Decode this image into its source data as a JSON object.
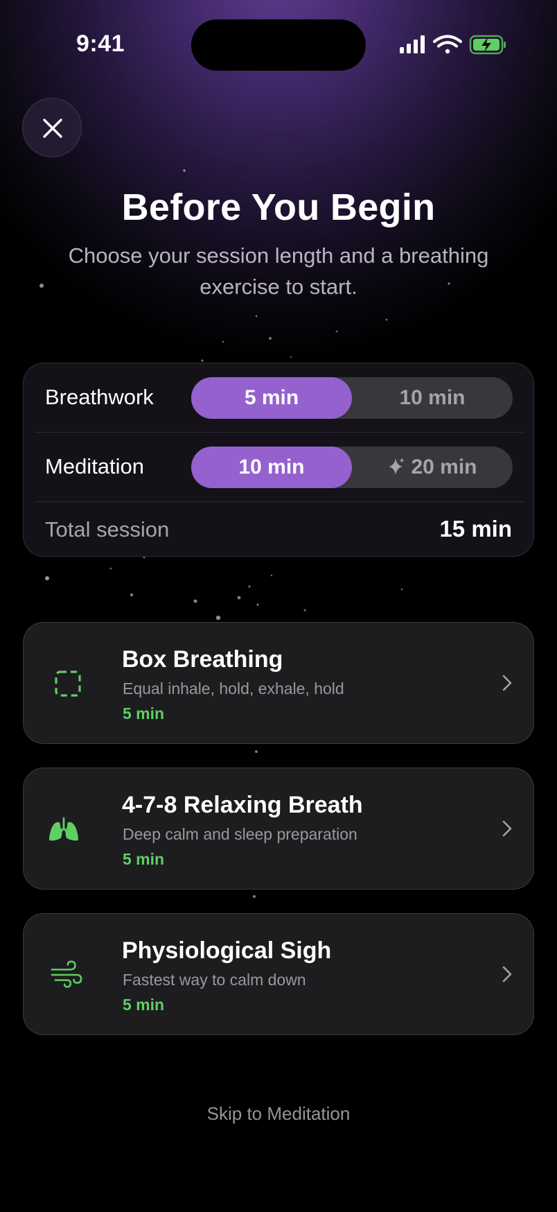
{
  "status_bar": {
    "time": "9:41",
    "icons": [
      "cellular-signal-icon",
      "wifi-icon",
      "battery-charging-icon"
    ]
  },
  "header": {
    "close_icon": "close-icon",
    "title": "Before You Begin",
    "subtitle": "Choose your session length and a breathing exercise to start."
  },
  "session": {
    "breathwork": {
      "label": "Breathwork",
      "options": [
        "5 min",
        "10 min"
      ],
      "selected": "5 min"
    },
    "meditation": {
      "label": "Meditation",
      "options": [
        "10 min",
        "20 min"
      ],
      "selected": "10 min",
      "premium_icon": "sparkle-icon"
    },
    "total": {
      "label": "Total session",
      "value": "15 min"
    }
  },
  "exercises": [
    {
      "title": "Box Breathing",
      "description": "Equal inhale, hold, exhale, hold",
      "duration": "5 min",
      "icon": "dashed-square-icon"
    },
    {
      "title": "4-7-8 Relaxing Breath",
      "description": "Deep calm and sleep preparation",
      "duration": "5 min",
      "icon": "lungs-icon"
    },
    {
      "title": "Physiological Sigh",
      "description": "Fastest way to calm down",
      "duration": "5 min",
      "icon": "wind-icon"
    }
  ],
  "footer": {
    "skip_label": "Skip to Meditation"
  },
  "colors": {
    "accent_purple": "#9461cf",
    "accent_green": "#5fcf63",
    "card_background": "#1e1e20"
  }
}
